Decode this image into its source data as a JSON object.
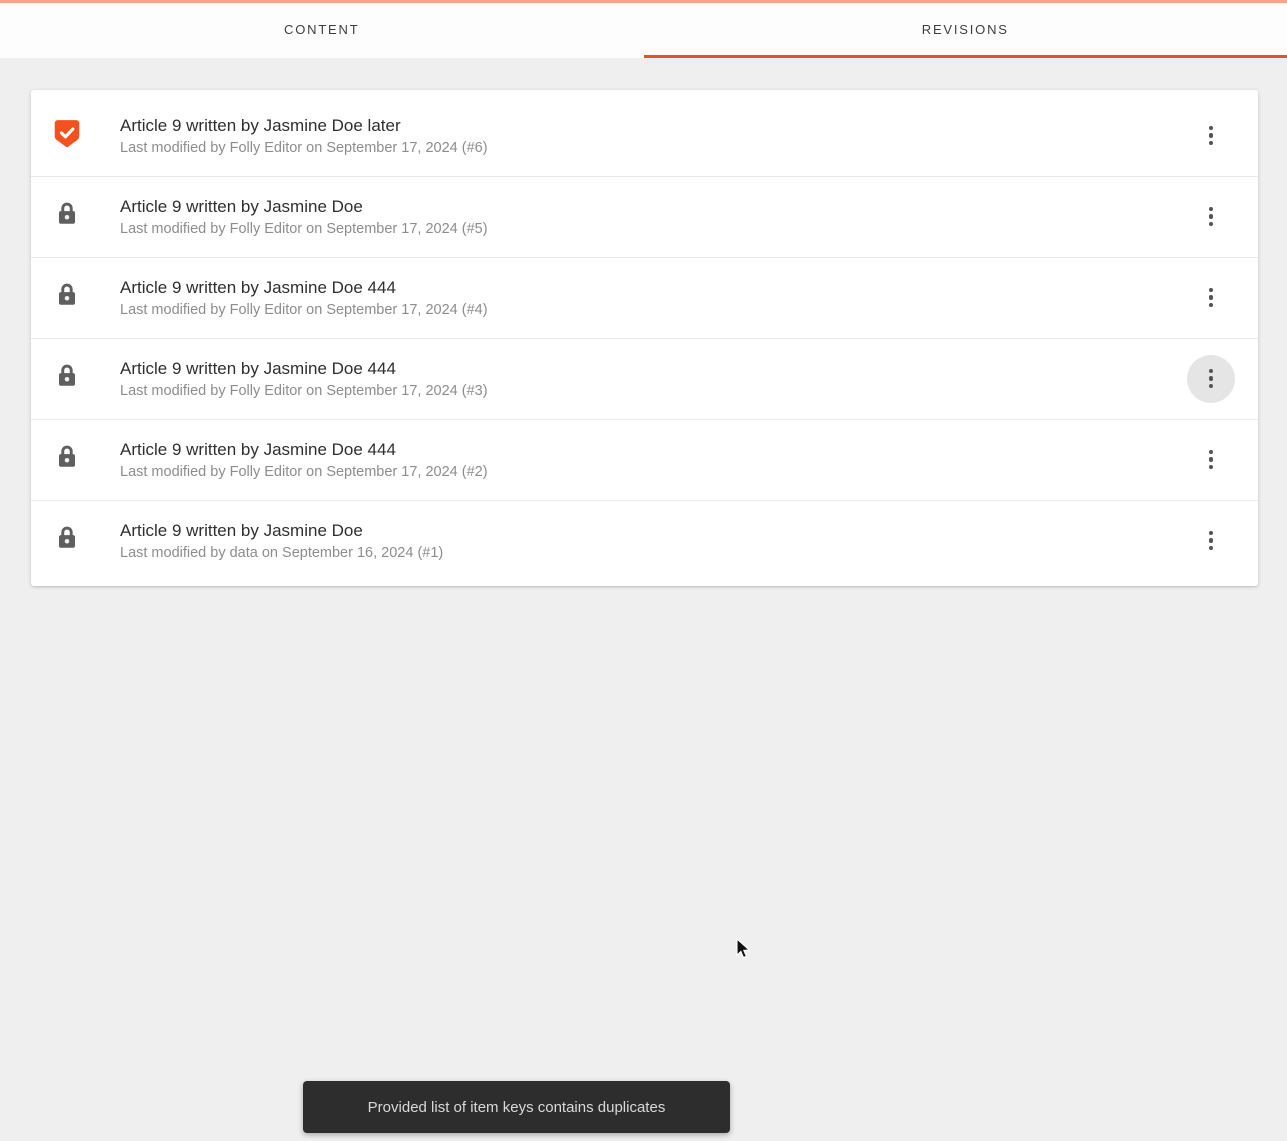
{
  "header": {
    "tabs": [
      {
        "label": "CONTENT",
        "active": false
      },
      {
        "label": "REVISIONS",
        "active": true
      }
    ]
  },
  "revisions": {
    "items": [
      {
        "title": "Article 9 written by Jasmine Doe later",
        "subtitle": "Last modified by Folly Editor on September 17, 2024 (#6)",
        "icon": "shield-check",
        "menu_hover": false
      },
      {
        "title": "Article 9 written by Jasmine Doe",
        "subtitle": "Last modified by Folly Editor on September 17, 2024 (#5)",
        "icon": "lock",
        "menu_hover": false
      },
      {
        "title": "Article 9 written by Jasmine Doe 444",
        "subtitle": "Last modified by Folly Editor on September 17, 2024 (#4)",
        "icon": "lock",
        "menu_hover": false
      },
      {
        "title": "Article 9 written by Jasmine Doe 444",
        "subtitle": "Last modified by Folly Editor on September 17, 2024 (#3)",
        "icon": "lock",
        "menu_hover": true
      },
      {
        "title": "Article 9 written by Jasmine Doe 444",
        "subtitle": "Last modified by Folly Editor on September 17, 2024 (#2)",
        "icon": "lock",
        "menu_hover": false
      },
      {
        "title": "Article 9 written by Jasmine Doe",
        "subtitle": "Last modified by data on September 16, 2024 (#1)",
        "icon": "lock",
        "menu_hover": false
      }
    ]
  },
  "toast": {
    "message": "Provided list of item keys contains duplicates"
  },
  "colors": {
    "top_line_salmon": "#f6a583",
    "accent_orange": "#e4561e",
    "badge_orange": "#f4511e",
    "lock_gray": "#5f5f5f",
    "toast_bg": "#2d2d2d",
    "page_bg": "#efefef"
  }
}
